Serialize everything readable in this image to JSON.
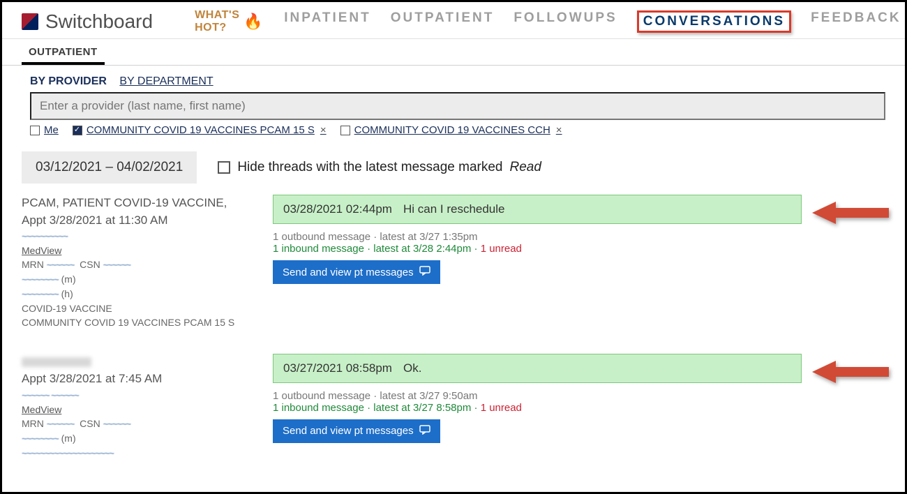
{
  "brand": {
    "name": "Switchboard"
  },
  "whats_hot": {
    "label": "WHAT'S HOT?"
  },
  "nav": {
    "items": [
      {
        "label": "INPATIENT",
        "active": false
      },
      {
        "label": "OUTPATIENT",
        "active": false
      },
      {
        "label": "FOLLOWUPS",
        "active": false
      },
      {
        "label": "CONVERSATIONS",
        "active": true
      },
      {
        "label": "FEEDBACK",
        "active": false
      }
    ]
  },
  "subtab": {
    "label": "OUTPATIENT"
  },
  "filter_tabs": {
    "by_provider": "BY PROVIDER",
    "by_department": "BY DEPARTMENT"
  },
  "provider_input": {
    "placeholder": "Enter a provider (last name, first name)"
  },
  "chips": [
    {
      "label": "Me",
      "checked": false,
      "closable": false
    },
    {
      "label": "COMMUNITY COVID 19 VACCINES PCAM 15 S",
      "checked": true,
      "closable": true
    },
    {
      "label": "COMMUNITY COVID 19 VACCINES CCH",
      "checked": false,
      "closable": true
    }
  ],
  "date_range": "03/12/2021 – 04/02/2021",
  "hide_read": {
    "prefix": "Hide threads with the latest message marked",
    "emph": "Read"
  },
  "threads": [
    {
      "left": {
        "title_line1": "PCAM, PATIENT COVID-19 VACCINE,",
        "title_line2": "Appt 3/28/2021 at 11:30 AM",
        "medview": "MedView",
        "mrn_label": "MRN",
        "csn_label": "CSN",
        "phone_m_suffix": "(m)",
        "phone_h_suffix": "(h)",
        "vaccine_line": "COVID-19 VACCINE",
        "dept_line": "COMMUNITY COVID 19 VACCINES PCAM 15 S"
      },
      "right": {
        "bubble": {
          "ts": "03/28/2021 02:44pm",
          "text": "Hi can I reschedule"
        },
        "outbound": "1 outbound message · latest at 3/27 1:35pm",
        "inbound_prefix": "1 inbound message · latest at 3/28 2:44pm · ",
        "unread": "1 unread",
        "button": "Send and view pt messages"
      }
    },
    {
      "left": {
        "title_line2": "Appt 3/28/2021 at 7:45 AM",
        "medview": "MedView",
        "mrn_label": "MRN",
        "csn_label": "CSN",
        "phone_m_suffix": "(m)"
      },
      "right": {
        "bubble": {
          "ts": "03/27/2021 08:58pm",
          "text": "Ok."
        },
        "outbound": "1 outbound message · latest at 3/27 9:50am",
        "inbound_prefix": "1 inbound message · latest at 3/27 8:58pm · ",
        "unread": "1 unread",
        "button": "Send and view pt messages"
      }
    }
  ]
}
